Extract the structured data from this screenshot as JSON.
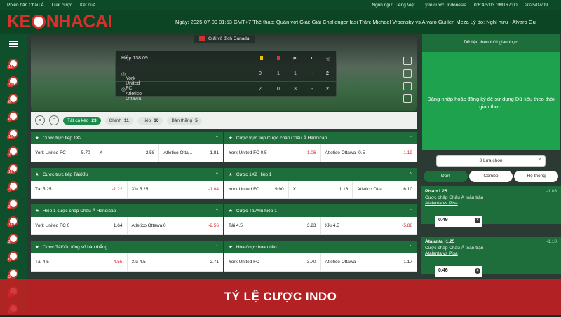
{
  "topbar": {
    "left": [
      "Phiên bản Châu Á",
      "Luật cược",
      "Kết quả"
    ],
    "right": [
      "Ngôn ngữ: Tiếng Việt",
      "Tỷ lệ cược: Indonesia",
      "0:6:4 5:03 GMT+7:00",
      "2025/07/09"
    ]
  },
  "header": {
    "logo": "KEONHACAI",
    "ticker": "Ngày: 2025-07-09 01:53 GMT+7 Thể thao: Quần vợt Giải: Giải Challenger Iasi Trận: Michael Vrbensky vs Alvaro Guillen Meza Lý do: Nghỉ hưu - Alvaro Gu"
  },
  "sidebar": {
    "badges": [
      "12",
      "10",
      "6",
      "6",
      "15",
      "2",
      "12",
      "3",
      "2",
      "14",
      "2",
      "6",
      "3",
      "12",
      "2"
    ]
  },
  "hero": {
    "league": "Giải vô địch Canada",
    "time": "Hiệp 138:09",
    "teams": [
      {
        "name": "York United FC",
        "s": [
          "0",
          "1",
          "1",
          "-",
          "2"
        ]
      },
      {
        "name": "Atletico Ottawa",
        "s": [
          "2",
          "0",
          "3",
          "-",
          "2"
        ]
      }
    ]
  },
  "filters": {
    "all": "Tất cả kèo",
    "all_n": "23",
    "main": "Chính",
    "main_n": "11",
    "half": "Hiệp",
    "half_n": "10",
    "corner": "Bàn thắng",
    "corner_n": "5"
  },
  "markets": [
    {
      "title": "Cược trực tiếp 1X2",
      "cells": [
        [
          "York United FC",
          "5.70"
        ],
        [
          "X",
          "2.58"
        ],
        [
          "Atletico Otta...",
          "1.81"
        ]
      ]
    },
    {
      "title": "Cược trực tiếp Cược chấp Châu Á Handicap",
      "cells": [
        [
          "York United FC  0.5",
          "-1.06"
        ],
        [
          "Atletico Ottawa  -0.5",
          "-1.19"
        ]
      ]
    },
    {
      "title": "Cược trực tiếp Tài/Xỉu",
      "cells": [
        [
          "Tài 5.25",
          "-1.22"
        ],
        [
          "Xỉu 5.25",
          "-1.04"
        ]
      ]
    },
    {
      "title": "Cược 1X2 Hiệp 1",
      "cells": [
        [
          "York United FC",
          "9.90"
        ],
        [
          "X",
          "1.18"
        ],
        [
          "Atletico Otta...",
          "6.10"
        ]
      ]
    },
    {
      "title": "Hiệp 1 cược chấp Châu Á Handicap",
      "cells": [
        [
          "York United FC  0",
          "1.64"
        ],
        [
          "Atletico Ottawa  0",
          "-2.56"
        ]
      ]
    },
    {
      "title": "Cược Tài/Xỉu hiệp 1",
      "cells": [
        [
          "Tài 4.5",
          "3.23"
        ],
        [
          "Xỉu 4.5",
          "-5.88"
        ]
      ]
    },
    {
      "title": "Cược Tài/Xỉu tổng số bàn thắng",
      "cells": [
        [
          "Tài 4.5",
          "-4.55"
        ],
        [
          "Xỉu 4.5",
          "2.71"
        ]
      ]
    },
    {
      "title": "Hòa được hoàn tiền",
      "cells": [
        [
          "York United FC",
          "3.70"
        ],
        [
          "Atletico Ottawa",
          "1.17"
        ]
      ]
    }
  ],
  "right": {
    "title": "Dữ liệu theo thời gian thực",
    "login": "Đăng nhập hoặc đăng ký để sử dụng Dữ liệu theo thời gian thực.",
    "choices": "3 Lựa chọn",
    "tabs": [
      "Đơn",
      "Combo",
      "Hệ thống"
    ],
    "slips": [
      {
        "title": "Pisa +1.25",
        "odd": "-1.03",
        "sub": "Cược chấp Châu Á toàn trận",
        "match": "Atalanta vs Pisa",
        "value": "0.49"
      },
      {
        "title": "Atalanta -1.25",
        "odd": "-1.10",
        "sub": "Cược chấp Châu Á toàn trận",
        "match": "Atalanta vs Pisa",
        "value": "0.46"
      }
    ]
  },
  "banner": "TỶ LỆ CƯỢC INDO"
}
